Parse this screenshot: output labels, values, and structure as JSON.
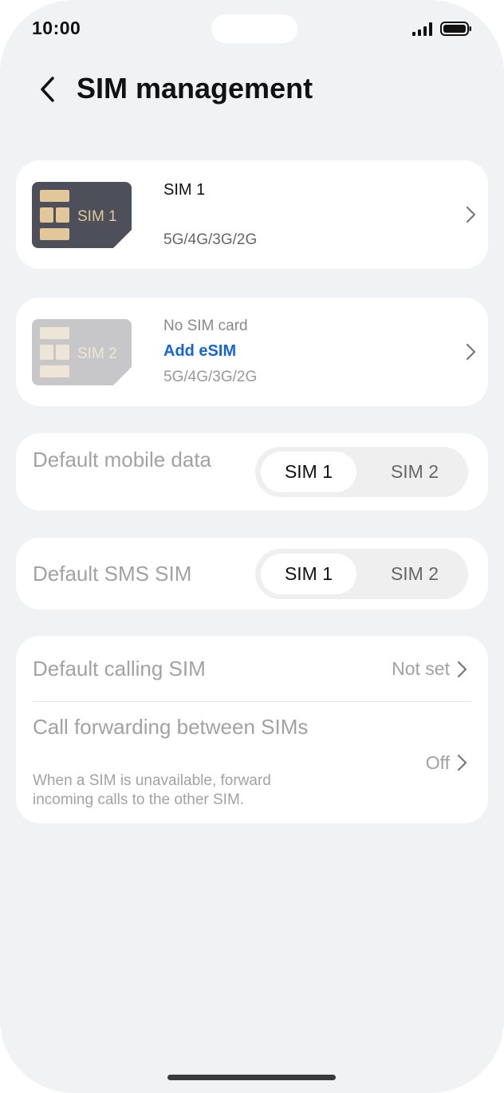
{
  "status_bar": {
    "time": "10:00",
    "icons": [
      "signal-icon",
      "battery-icon"
    ]
  },
  "header": {
    "title": "SIM management",
    "back_icon": "chevron-left-icon"
  },
  "sims": [
    {
      "card_label": "SIM 1",
      "name": "SIM 1",
      "network": "5G/4G/3G/2G",
      "card_color": "#4d4f5a"
    },
    {
      "card_label": "SIM 2",
      "status": "No SIM card",
      "action": "Add eSIM",
      "network": "5G/4G/3G/2G",
      "card_color": "#c7c7c9"
    }
  ],
  "default_mobile_data": {
    "label": "Default mobile data",
    "options": [
      "SIM 1",
      "SIM 2"
    ],
    "selected": "SIM 1"
  },
  "default_sms": {
    "label": "Default SMS SIM",
    "options": [
      "SIM 1",
      "SIM 2"
    ],
    "selected": "SIM 1"
  },
  "calling": {
    "default_calling_label": "Default calling SIM",
    "default_calling_value": "Not set",
    "forwarding_label": "Call forwarding between SIMs",
    "forwarding_desc": "When a SIM is unavailable, forward incoming calls to the other SIM.",
    "forwarding_value": "Off"
  },
  "colors": {
    "accent": "#1565d8",
    "background": "#f1f2f4",
    "card": "#ffffff"
  }
}
